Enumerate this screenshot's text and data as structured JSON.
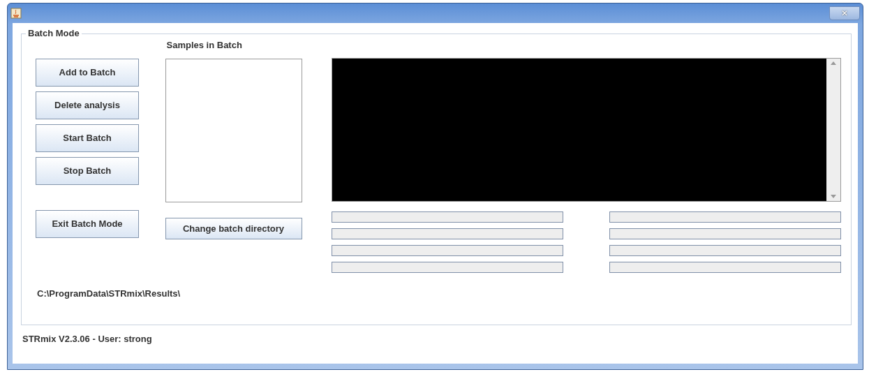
{
  "window": {
    "close_glyph": "✕"
  },
  "group": {
    "title": "Batch Mode",
    "buttons": [
      "Add to Batch",
      "Delete analysis",
      "Start Batch",
      "Stop Batch"
    ],
    "exit_button": "Exit Batch Mode",
    "samples": {
      "label": "Samples in Batch"
    },
    "change_button": "Change batch directory",
    "path": "C:\\ProgramData\\STRmix\\Results\\",
    "progress_left": [
      {
        "level": 0
      },
      {
        "level": 0
      },
      {
        "level": 0
      },
      {
        "level": 0
      }
    ],
    "progress_right": [
      {
        "level": 0
      },
      {
        "level": 0
      },
      {
        "level": 0
      },
      {
        "level": 0
      }
    ]
  },
  "status_bar": "STRmix V2.3.06 - User: strong"
}
